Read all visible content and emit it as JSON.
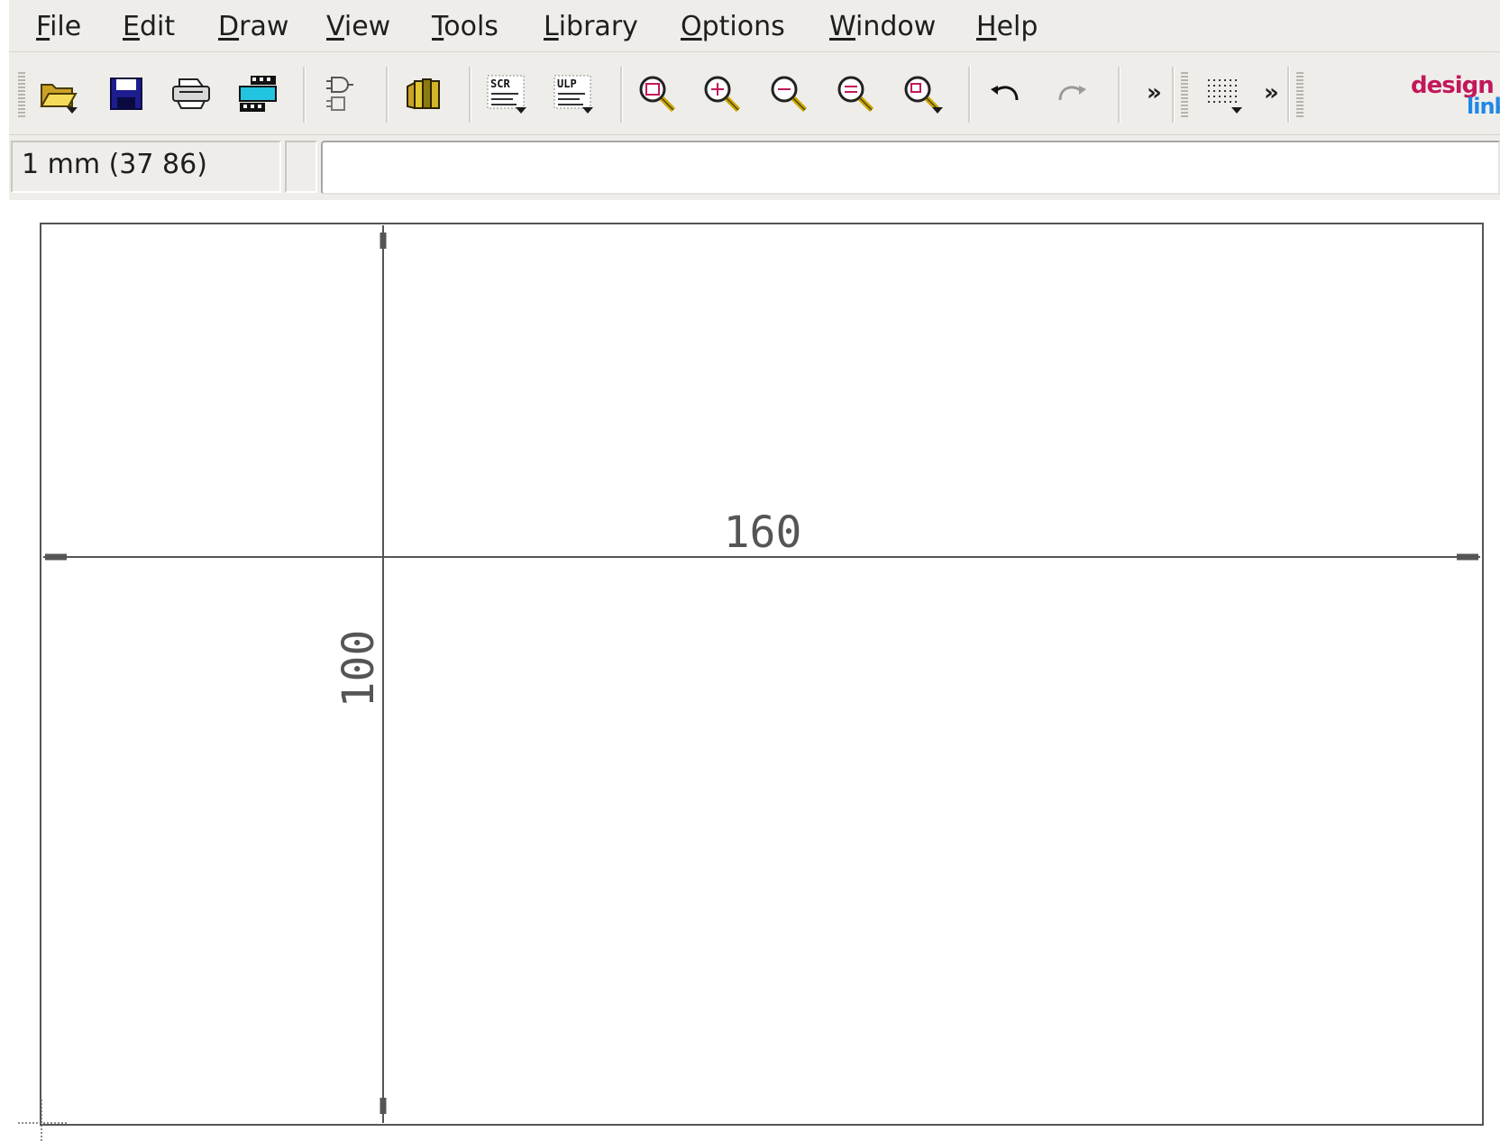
{
  "menu": {
    "items": [
      {
        "id": "file",
        "accel": "F",
        "rest": "ile"
      },
      {
        "id": "edit",
        "accel": "E",
        "rest": "dit"
      },
      {
        "id": "draw",
        "accel": "D",
        "rest": "raw"
      },
      {
        "id": "view",
        "accel": "V",
        "rest": "iew"
      },
      {
        "id": "tools",
        "accel": "T",
        "rest": "ools"
      },
      {
        "id": "library",
        "accel": "L",
        "rest": "ibrary"
      },
      {
        "id": "options",
        "accel": "O",
        "rest": "ptions"
      },
      {
        "id": "window",
        "accel": "W",
        "rest": "indow"
      },
      {
        "id": "help",
        "accel": "H",
        "rest": "elp"
      }
    ]
  },
  "toolbar": {
    "icons": {
      "open": "folder-open-icon",
      "save": "floppy-save-icon",
      "print": "printer-icon",
      "cam": "cam-processor-icon",
      "switch": "schematic-board-switch-icon",
      "library": "library-books-icon",
      "script": "script-icon",
      "ulp": "ulp-icon",
      "zoom_fit": "zoom-fit-icon",
      "zoom_in": "zoom-in-icon",
      "zoom_out": "zoom-out-icon",
      "redraw": "zoom-redraw-icon",
      "zoom_select": "zoom-select-icon",
      "undo": "undo-icon",
      "redo": "redo-icon",
      "grid": "grid-icon"
    },
    "script_label": "SCR",
    "ulp_label": "ULP",
    "more": "»",
    "logo_top": "design",
    "logo_bottom": "link"
  },
  "command": {
    "coordinates": "1 mm (37 86)",
    "input_value": ""
  },
  "board": {
    "width_label": "160",
    "height_label": "100"
  }
}
